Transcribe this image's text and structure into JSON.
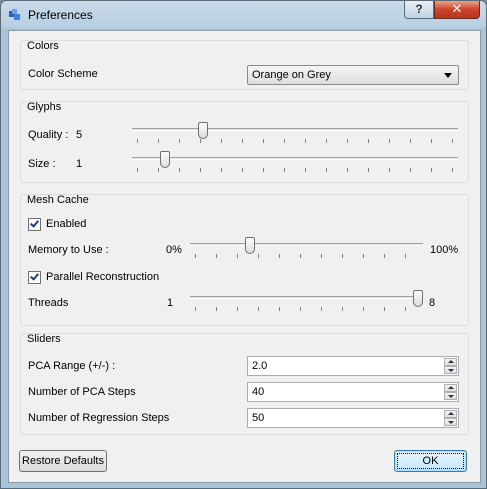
{
  "window": {
    "title": "Preferences",
    "help_label": "?",
    "close_label": "✕",
    "icon": "app-icon"
  },
  "colors": {
    "title": "Colors",
    "color_scheme_label": "Color Scheme",
    "color_scheme_value": "Orange on Grey"
  },
  "glyphs": {
    "title": "Glyphs",
    "quality_label": "Quality :",
    "quality_value": "5",
    "size_label": "Size :",
    "size_value": "1"
  },
  "mesh_cache": {
    "title": "Mesh Cache",
    "enabled_label": "Enabled",
    "enabled_checked": true,
    "memory_label": "Memory to Use :",
    "memory_min": "0%",
    "memory_max": "100%",
    "parallel_label": "Parallel Reconstruction",
    "parallel_checked": true,
    "threads_label": "Threads",
    "threads_min": "1",
    "threads_max": "8"
  },
  "sliders": {
    "title": "Sliders",
    "pca_range_label": "PCA Range (+/-) :",
    "pca_range_value": "2.0",
    "pca_steps_label": "Number of PCA Steps",
    "pca_steps_value": "40",
    "regression_steps_label": "Number of Regression Steps",
    "regression_steps_value": "50"
  },
  "buttons": {
    "restore_defaults": "Restore Defaults",
    "ok": "OK"
  }
}
